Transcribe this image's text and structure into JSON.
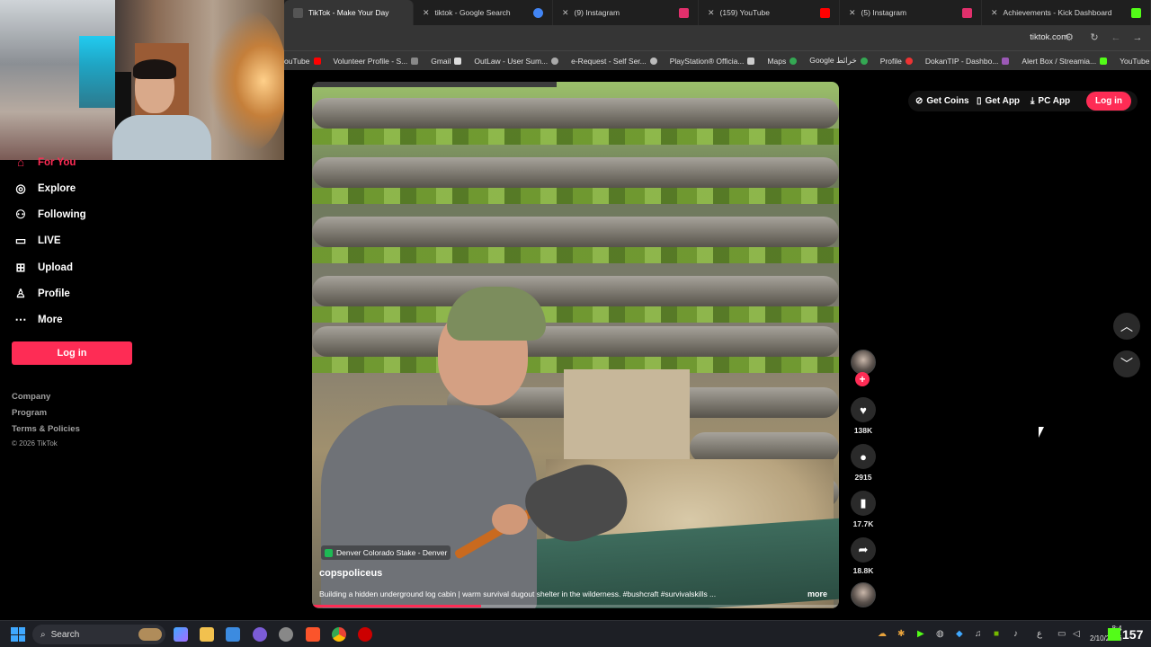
{
  "browser": {
    "tabs": [
      {
        "label": "TikTok - Make Your Day",
        "active": true
      },
      {
        "label": "tiktok - Google Search",
        "active": false
      },
      {
        "label": "(9) Instagram",
        "active": false
      },
      {
        "label": "(159) YouTube",
        "active": false
      },
      {
        "label": "(5) Instagram",
        "active": false
      },
      {
        "label": "Achievements - Kick Dashboard",
        "active": false
      }
    ],
    "url": "tiktok.com",
    "bookmarks": [
      "ouTube",
      "Volunteer Profile - S...",
      "Gmail",
      "OutLaw - User Sum...",
      "e-Request - Self Ser...",
      "PlayStation® Officia...",
      "Maps",
      "Google خرائط",
      "Profile",
      "DokanTIP - Dashbo...",
      "Alert Box / Streamia...",
      "YouTube"
    ]
  },
  "sidebar": {
    "items": [
      {
        "label": "For You",
        "icon": "home-icon"
      },
      {
        "label": "Explore",
        "icon": "compass-icon"
      },
      {
        "label": "Following",
        "icon": "following-icon"
      },
      {
        "label": "LIVE",
        "icon": "live-icon"
      },
      {
        "label": "Upload",
        "icon": "upload-icon"
      },
      {
        "label": "Profile",
        "icon": "person-icon"
      },
      {
        "label": "More",
        "icon": "more-icon"
      }
    ],
    "login_label": "Log in",
    "footer": [
      "Company",
      "Program",
      "Terms & Policies",
      "© 2026 TikTok"
    ]
  },
  "header_actions": {
    "get_coins": "Get Coins",
    "get_app": "Get App",
    "pc_app": "PC App",
    "login": "Log in"
  },
  "video": {
    "location": "Denver Colorado Stake - Denver",
    "author": "copspoliceus",
    "caption": "Building a hidden underground log cabin | warm survival dugout shelter in the wilderness. #bushcraft #survivalskills ...",
    "more_label": "more",
    "progress": 0.32
  },
  "actions": {
    "likes": "138K",
    "comments": "2915",
    "saves": "17.7K",
    "shares": "18.8K"
  },
  "taskbar": {
    "search_label": "Search",
    "time": "8:4",
    "date": "2/10/2026",
    "kick_count": "157"
  },
  "colors": {
    "accent": "#fe2c55",
    "kick": "#53fc18"
  }
}
